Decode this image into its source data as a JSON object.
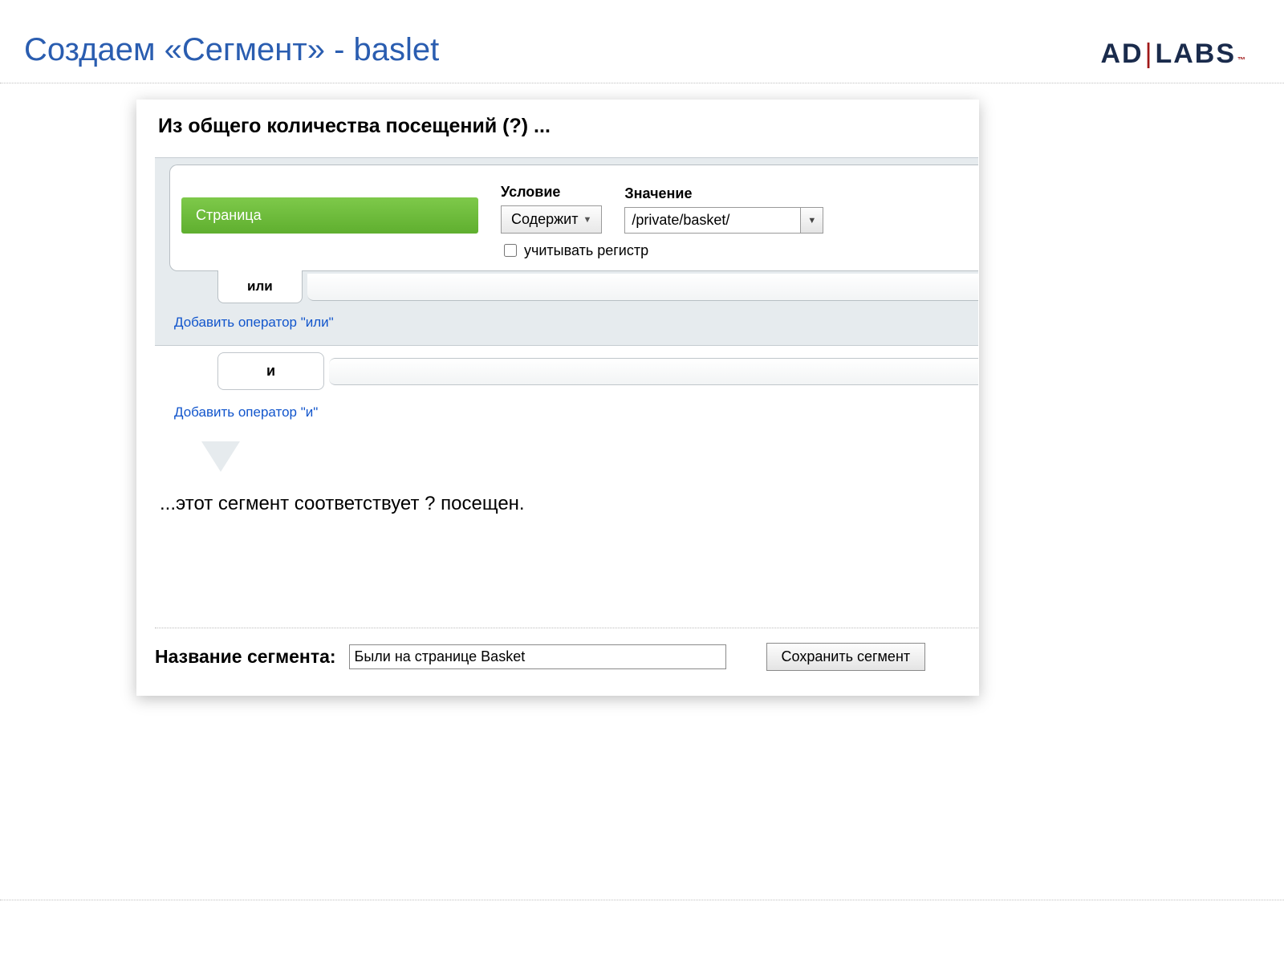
{
  "slide": {
    "title": "Создаем «Сегмент» - baslet"
  },
  "logo": {
    "left": "AD",
    "right": "LABS",
    "tm": "™"
  },
  "panel": {
    "heading": "Из общего количества посещений (?) ...",
    "dimension": "Страница",
    "condition_label": "Условие",
    "condition_value": "Содержит",
    "value_label": "Значение",
    "value_value": "/private/basket/",
    "case_label": "учитывать регистр",
    "or_label": "или",
    "add_or": "Добавить оператор \"или\"",
    "and_label": "и",
    "add_and": "Добавить оператор \"и\"",
    "result": "...этот сегмент соответствует ? посещен.",
    "name_label": "Название сегмента:",
    "name_value": "Были на странице Basket",
    "save_label": "Сохранить сегмент"
  }
}
